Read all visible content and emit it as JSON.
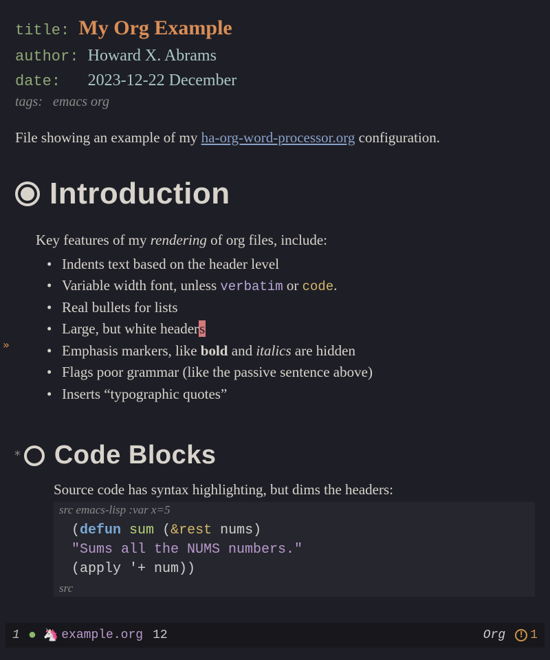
{
  "meta": {
    "title_key": "title",
    "title_val": "My Org Example",
    "author_key": "author",
    "author_val": "Howard X. Abrams",
    "date_key": "date",
    "date_val": "2023-12-22 December",
    "tags_key": "tags:",
    "tags_val": "emacs org"
  },
  "description": {
    "prefix": "File showing an example of my ",
    "link": "ha-org-word-processor.org",
    "suffix": " configuration."
  },
  "section1": {
    "title": "Introduction",
    "para_prefix": "Key features of my ",
    "para_italic": "rendering",
    "para_suffix": " of org files, include:",
    "bullets": {
      "b1": "Indents text based on the header level",
      "b2_prefix": "Variable width font, unless ",
      "b2_verbatim": "verbatim",
      "b2_mid": " or ",
      "b2_code": "code",
      "b2_suffix": ".",
      "b3": "Real bullets for lists",
      "b4_prefix": "Large, but white header",
      "b4_cursor": "s",
      "b5_prefix": "Emphasis markers, like ",
      "b5_bold": "bold",
      "b5_mid": " and ",
      "b5_italic": "italics",
      "b5_suffix": " are hidden",
      "b6": "Flags poor grammar (like the passive sentence above)",
      "b7": "Inserts “typographic quotes”"
    }
  },
  "section2": {
    "star": "*",
    "title": "Code Blocks",
    "para": "Source code has syntax highlighting, but dims the headers:",
    "src_header_prefix": "src",
    "src_header_rest": " emacs-lisp :var x=5",
    "src_footer": "src",
    "code": {
      "l1_open": "(",
      "l1_kw": "defun",
      "l1_sp1": " ",
      "l1_fn": "sum",
      "l1_sp2": " (",
      "l1_amp": "&rest",
      "l1_sp3": " nums)",
      "l2_indent": "  ",
      "l2_str": "\"Sums all the NUMS numbers.\"",
      "l3_indent": "  ",
      "l3_body": "(apply '+ num))"
    }
  },
  "modeline": {
    "winnum": "1",
    "filename": "example.org",
    "line": "12",
    "mode": "Org",
    "warn_count": "1"
  },
  "fringe": "»"
}
